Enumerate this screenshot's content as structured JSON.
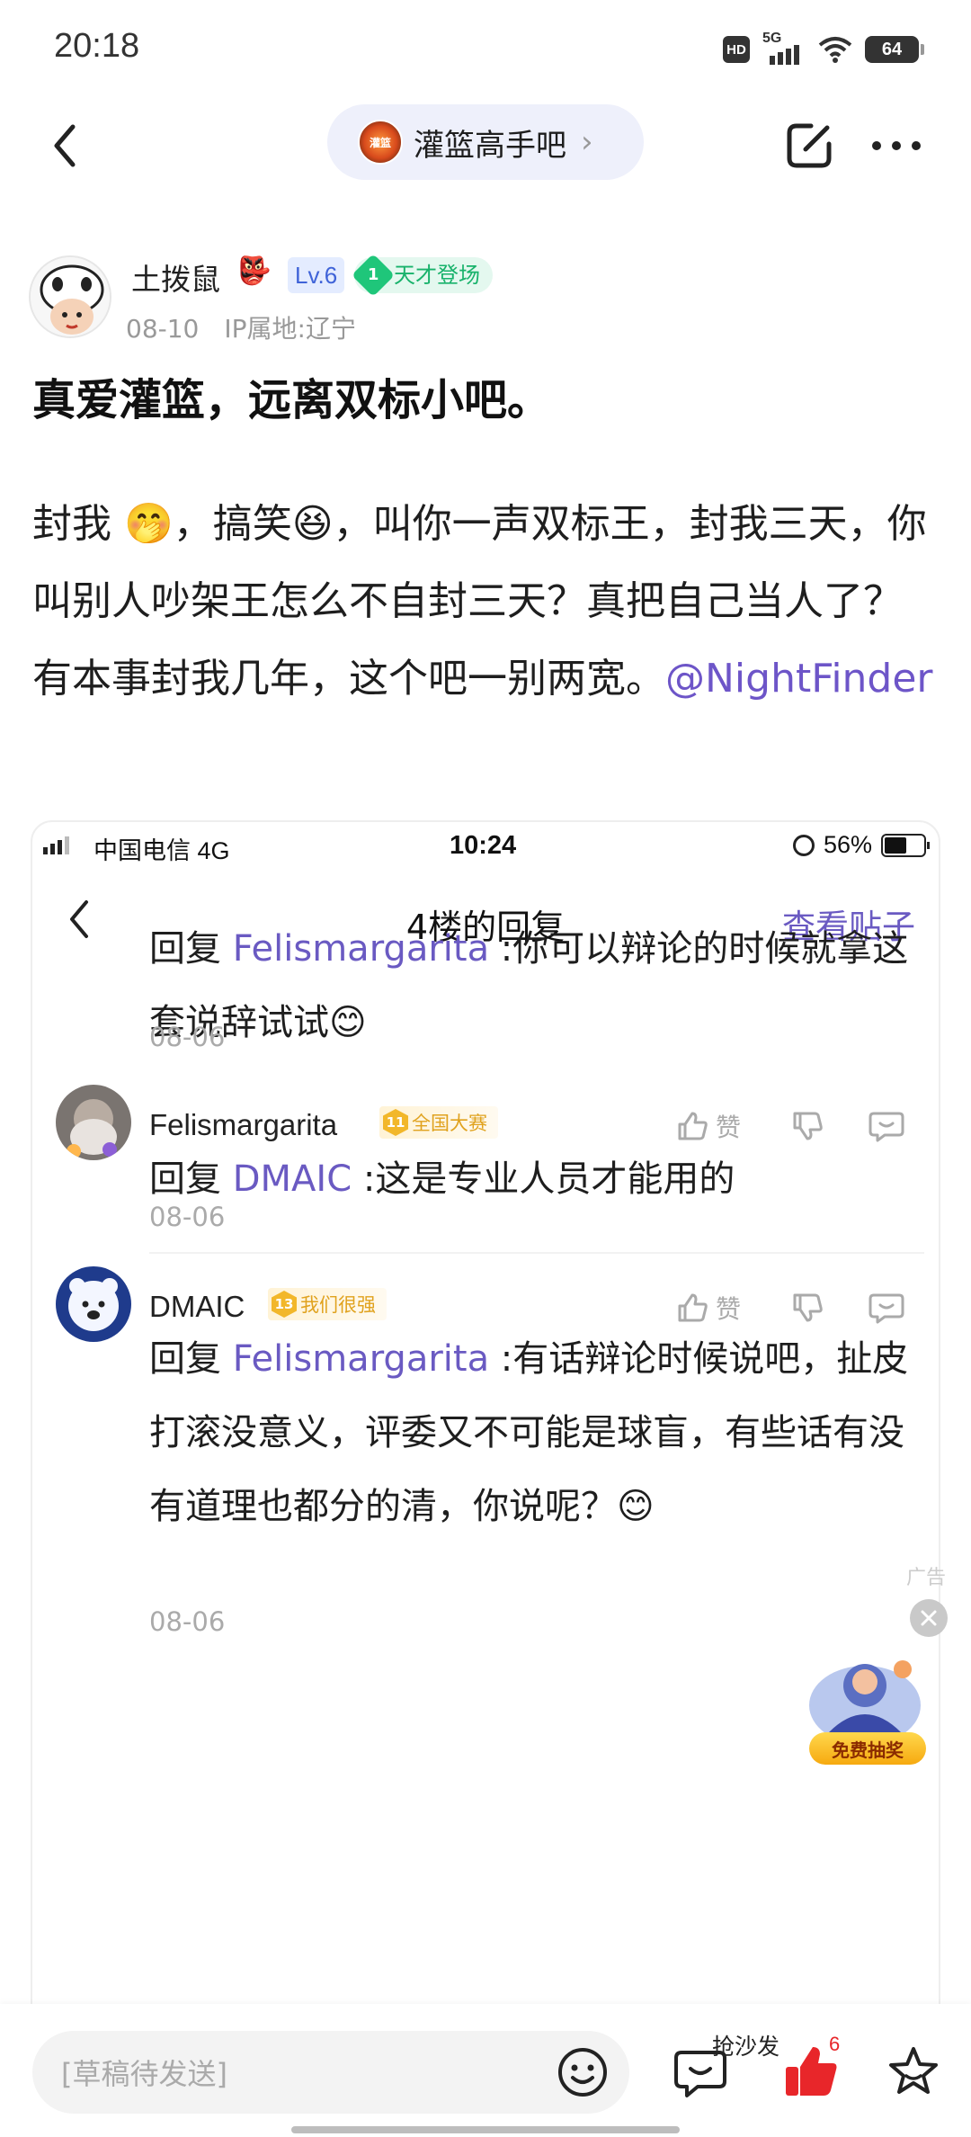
{
  "status_bar": {
    "time": "20:18",
    "hd": "HD",
    "network": "5G",
    "battery": "64"
  },
  "nav": {
    "forum_name": "灌篮高手吧",
    "forum_logo_text": "灌篮",
    "forum_chevron": "›"
  },
  "author": {
    "name": "土拨鼠",
    "emoji": "👺",
    "level": "Lv.6",
    "badge_num": "1",
    "badge_label": "天才登场",
    "date": "08-10",
    "ip": "IP属地:辽宁"
  },
  "post": {
    "title": "真爱灌篮，远离双标小吧。",
    "body_before_mention": "封我 🤭，搞笑😆，叫你一声双标王，封我三天，你叫别人吵架王怎么不自封三天？真把自己当人了？有本事封我几年，这个吧一别两宽。",
    "mention": "@NightFinder"
  },
  "embed": {
    "carrier": "中国电信  4G",
    "time": "10:24",
    "battery": "56%",
    "title": "4楼的回复",
    "view_post": "查看贴子",
    "first_reply": {
      "prefix": "回复 ",
      "target": "Felismargarita",
      "text": " :你可以辩论的时候就拿这套说辞试试😊",
      "date": "08-06"
    },
    "comments": [
      {
        "name": "Felismargarita",
        "badge_num": "11",
        "badge_label": "全国大赛",
        "like": "赞",
        "prefix": "回复 ",
        "target": "DMAIC",
        "text": " :这是专业人员才能用的",
        "date": "08-06"
      },
      {
        "name": "DMAIC",
        "badge_num": "13",
        "badge_label": "我们很强",
        "like": "赞",
        "prefix": "回复 ",
        "target": "Felismargarita",
        "text": " :有话辩论时候说吧，扯皮打滚没意义，评委又不可能是球盲，有些话有没有道理也都分的清，你说呢？😊",
        "date": "08-06"
      }
    ]
  },
  "ad": {
    "label": "广告",
    "button": "免费抽奖"
  },
  "bottom": {
    "draft_placeholder": "[草稿待发送]",
    "sofa": "抢沙发",
    "like_count": "6"
  },
  "colors": {
    "accent_purple": "#6a5ac2",
    "like_red": "#e8262a",
    "talent_green": "#18b26b",
    "badge_gold": "#e0a21e"
  }
}
